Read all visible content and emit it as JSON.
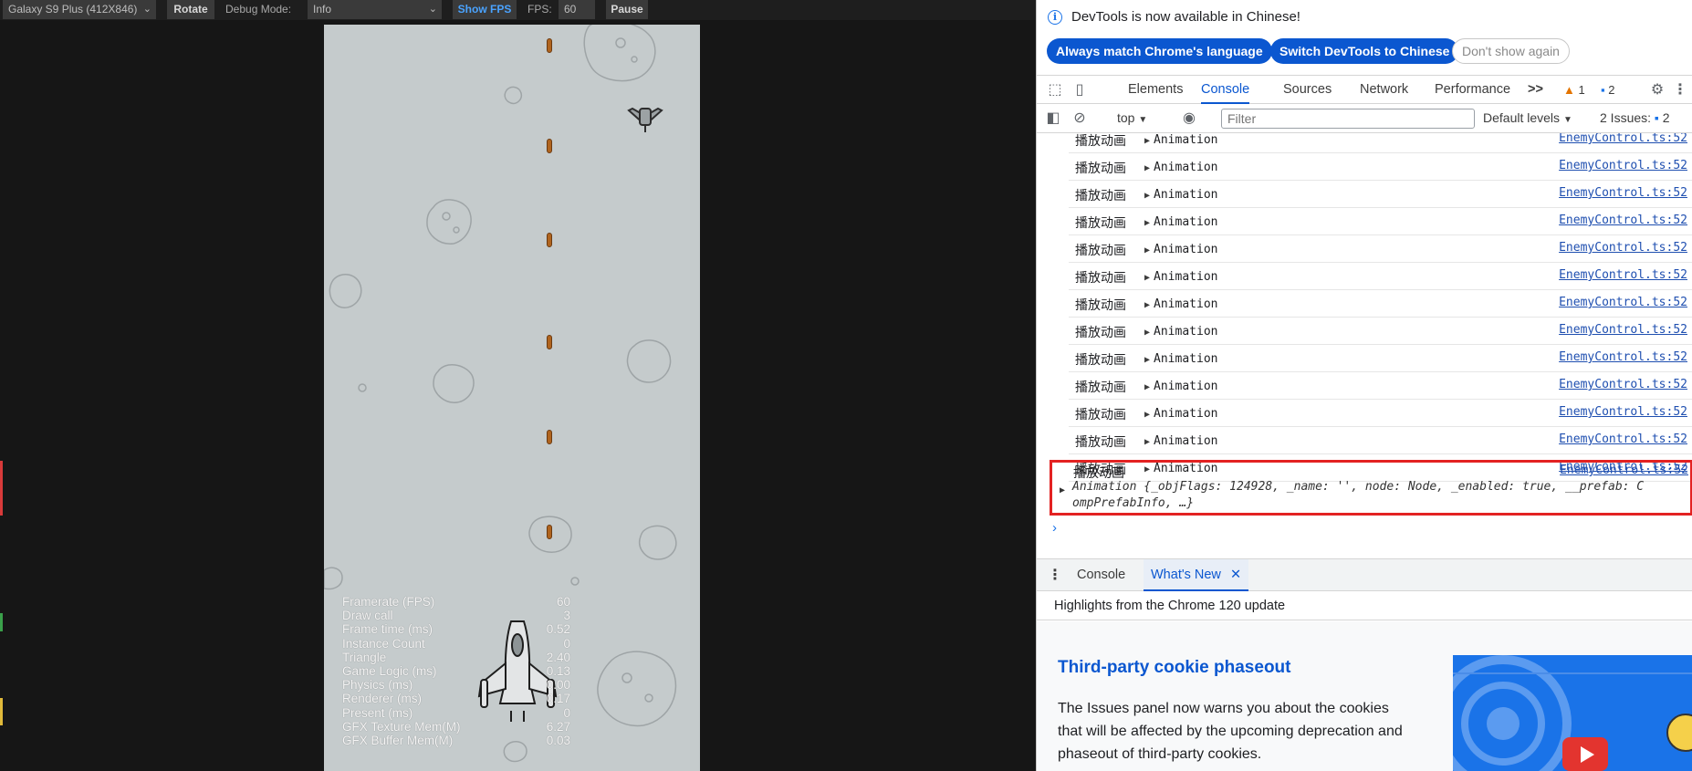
{
  "simulator": {
    "device_select": "Galaxy S9 Plus (412X846)",
    "rotate_label": "Rotate",
    "debug_mode_label": "Debug Mode:",
    "debug_mode_value": "Info",
    "show_fps_label": "Show FPS",
    "fps_label": "FPS:",
    "fps_value": "60",
    "pause_label": "Pause"
  },
  "stats": [
    {
      "label": "Framerate (FPS)",
      "value": "60"
    },
    {
      "label": "Draw call",
      "value": "3"
    },
    {
      "label": "Frame time (ms)",
      "value": "0.52"
    },
    {
      "label": "Instance Count",
      "value": "0"
    },
    {
      "label": "Triangle",
      "value": "2.40"
    },
    {
      "label": "Game Logic (ms)",
      "value": "0.13"
    },
    {
      "label": "Physics (ms)",
      "value": "0.00"
    },
    {
      "label": "Renderer (ms)",
      "value": "0.17"
    },
    {
      "label": "Present (ms)",
      "value": "0"
    },
    {
      "label": "GFX Texture Mem(M)",
      "value": "6.27"
    },
    {
      "label": "GFX Buffer Mem(M)",
      "value": "0.03"
    }
  ],
  "devtools": {
    "info_text": "DevTools is now available in Chinese!",
    "btn_match_language": "Always match Chrome's language",
    "btn_switch_chinese": "Switch DevTools to Chinese",
    "btn_dont_show": "Don't show again",
    "tabs": [
      "Elements",
      "Console",
      "Sources",
      "Network",
      "Performance"
    ],
    "more_tabs": ">>",
    "warn_count": "1",
    "msg_count": "2",
    "context": "top",
    "filter_placeholder": "Filter",
    "levels": "Default levels",
    "issues_label": "2 Issues:",
    "issues_count": "2",
    "log_message": "播放动画",
    "log_object": "Animation",
    "log_source": "EnemyControl.ts:52",
    "last_entry": {
      "message": "播放动画",
      "source": "EnemyControl.ts:52",
      "detail_line1": "Animation {_objFlags: 124928, _name: '', node: Node, _enabled: true, __prefab: C",
      "detail_line2": "ompPrefabInfo, …}"
    },
    "prompt": "›",
    "drawer_tabs": [
      "Console",
      "What's New"
    ],
    "close_glyph": "✕",
    "highlights": "Highlights from the Chrome 120 update",
    "whats_new_title": "Third-party cookie phaseout",
    "whats_new_text": "The Issues panel now warns you about the cookies that will be affected by the upcoming deprecation and phaseout of third-party cookies."
  },
  "colors": {
    "game_bg": "#c5cbcc",
    "accent": "#0b57d0",
    "highlight_box": "#e32222"
  }
}
